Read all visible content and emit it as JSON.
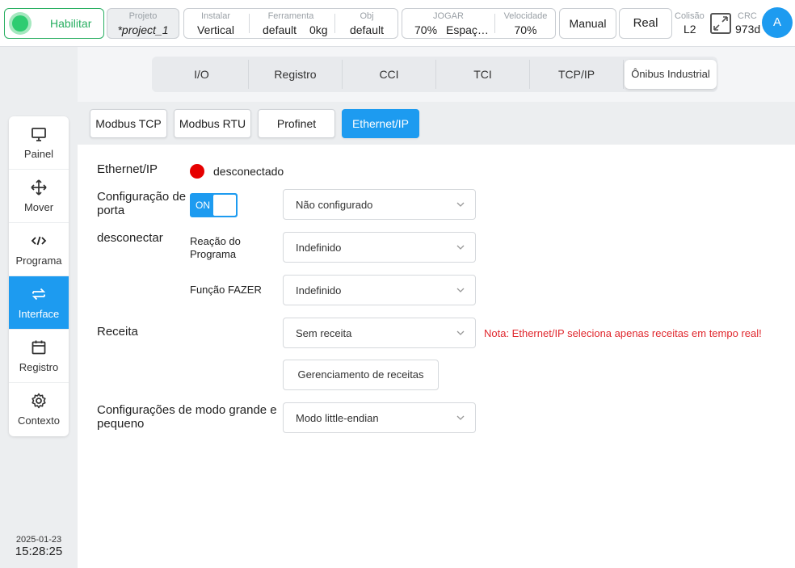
{
  "topbar": {
    "enable_label": "Habilitar",
    "project": {
      "label": "Projeto",
      "value": "*project_1"
    },
    "install": {
      "label": "Instalar",
      "value": "Vertical"
    },
    "tool": {
      "label": "Ferramenta",
      "value": "default",
      "weight": "0kg"
    },
    "obj": {
      "label": "Obj",
      "value": "default"
    },
    "jog": {
      "label": "JOGAR",
      "value": "70%",
      "space": "Espaç…"
    },
    "speed": {
      "label": "Velocidade",
      "value": "70%"
    },
    "manual_label": "Manual",
    "real_label": "Real",
    "collision": {
      "label": "Colisão",
      "value": "L2"
    },
    "crc": {
      "label": "CRC",
      "value": "973d"
    },
    "avatar_letter": "A"
  },
  "sidebar": {
    "items": [
      {
        "label": "Painel",
        "icon": "monitor-icon"
      },
      {
        "label": "Mover",
        "icon": "move-arrows-icon"
      },
      {
        "label": "Programa",
        "icon": "code-icon"
      },
      {
        "label": "Interface",
        "icon": "swap-arrows-icon",
        "active": true
      },
      {
        "label": "Registro",
        "icon": "calendar-icon"
      },
      {
        "label": "Contexto",
        "icon": "gear-icon"
      }
    ]
  },
  "clock": {
    "date": "2025-01-23",
    "time": "15:28:25"
  },
  "tabs": [
    "I/O",
    "Registro",
    "CCI",
    "TCI",
    "TCP/IP",
    "Ônibus Industrial"
  ],
  "active_tab": "Ônibus Industrial",
  "subtabs": [
    "Modbus TCP",
    "Modbus RTU",
    "Profinet",
    "Ethernet/IP"
  ],
  "active_subtab": "Ethernet/IP",
  "form": {
    "ethernet_label": "Ethernet/IP",
    "status_text": "desconectado",
    "status_color": "#e60000",
    "port_config_label": "Configuração de porta",
    "toggle_text": "ON",
    "port_config_value": "Não configurado",
    "disconnect_label": "desconectar",
    "program_reaction_label": "Reação do Programa",
    "program_reaction_value": "Indefinido",
    "do_function_label": "Função FAZER",
    "do_function_value": "Indefinido",
    "recipe_label": "Receita",
    "recipe_value": "Sem receita",
    "recipe_note": "Nota: Ethernet/IP seleciona apenas receitas em tempo real!",
    "manage_recipes_label": "Gerenciamento de receitas",
    "endian_label": "Configurações de modo grande e pequeno",
    "endian_value": "Modo little-endian"
  },
  "colors": {
    "accent": "#1d9bf0",
    "enable": "#27ae60",
    "warning": "#e0282e"
  }
}
